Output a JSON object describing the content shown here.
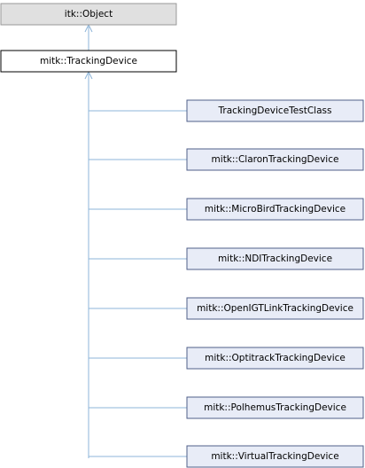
{
  "diagram": {
    "root": {
      "label": "itk::Object"
    },
    "current": {
      "label": "mitk::TrackingDevice"
    },
    "children": [
      {
        "label": "TrackingDeviceTestClass"
      },
      {
        "label": "mitk::ClaronTrackingDevice"
      },
      {
        "label": "mitk::MicroBirdTrackingDevice"
      },
      {
        "label": "mitk::NDITrackingDevice"
      },
      {
        "label": "mitk::OpenIGTLinkTrackingDevice"
      },
      {
        "label": "mitk::OptitrackTrackingDevice"
      },
      {
        "label": "mitk::PolhemusTrackingDevice"
      },
      {
        "label": "mitk::VirtualTrackingDevice"
      }
    ],
    "colors": {
      "edge": "#8db4d8",
      "root_fill": "#e0e0e0",
      "child_fill": "#e8ecf7",
      "child_border": "#4f5f88"
    }
  }
}
